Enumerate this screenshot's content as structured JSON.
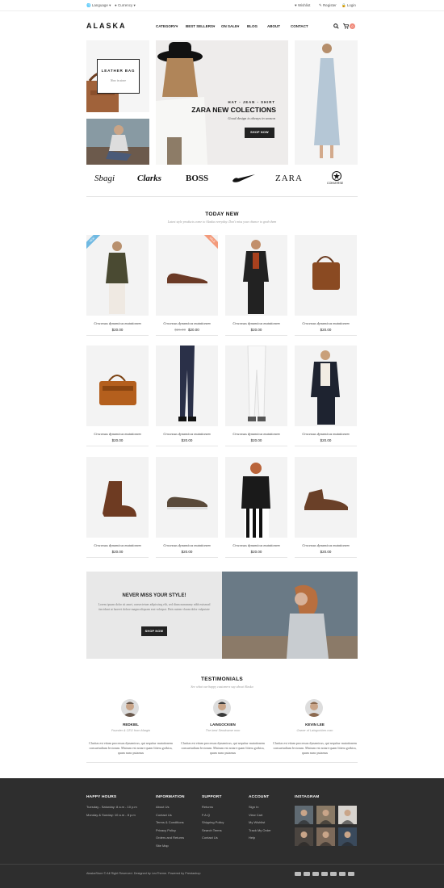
{
  "topbar": {
    "language": "Language",
    "currency": "Currency",
    "wishlist": "Wishlist",
    "register": "Register",
    "login": "Login"
  },
  "header": {
    "logo": "ALASKA",
    "nav": [
      "CATEGORY",
      "BEST SELLERS",
      "ON SALE",
      "BLOG",
      "ABOUT",
      "CONTACT"
    ],
    "cart_count": "0"
  },
  "hero": {
    "leather_title": "LEATHER BAG",
    "leather_sub": "Now in store",
    "tag": "HAT - JEAN - SHIRT",
    "title": "ZARA NEW COLECTIONS",
    "subtitle": "Good design is always in season",
    "button": "SHOP NOW"
  },
  "brands": [
    "Sbagi",
    "Clarks",
    "BOSS",
    "nike",
    "ZARA",
    "CONVERSE"
  ],
  "today": {
    "title": "TODAY NEW",
    "subtitle": "Latest style products come to Alaska everyday. Don't miss your chance to grab them"
  },
  "products": [
    {
      "name": "Crocessus dynamicus mutationem",
      "price": "$20.00",
      "old": "",
      "badge": "NEW"
    },
    {
      "name": "Crocessus dynamicus mutationem",
      "price": "$20.00",
      "old": "$26.00",
      "badge": "SALE"
    },
    {
      "name": "Crocessus dynamicus mutationem",
      "price": "$20.00",
      "old": "",
      "badge": ""
    },
    {
      "name": "Crocessus dynamicus mutationem",
      "price": "$20.00",
      "old": "",
      "badge": ""
    },
    {
      "name": "Crocessus dynamicus mutationem",
      "price": "$20.00",
      "old": "",
      "badge": ""
    },
    {
      "name": "Crocessus dynamicus mutationem",
      "price": "$20.00",
      "old": "",
      "badge": ""
    },
    {
      "name": "Crocessus dynamicus mutationem",
      "price": "$20.00",
      "old": "",
      "badge": ""
    },
    {
      "name": "Crocessus dynamicus mutationem",
      "price": "$20.00",
      "old": "",
      "badge": ""
    },
    {
      "name": "Crocessus dynamicus mutationem",
      "price": "$20.00",
      "old": "",
      "badge": ""
    },
    {
      "name": "Crocessus dynamicus mutationem",
      "price": "$20.00",
      "old": "",
      "badge": ""
    },
    {
      "name": "Crocessus dynamicus mutationem",
      "price": "$20.00",
      "old": "",
      "badge": ""
    },
    {
      "name": "Crocessus dynamicus mutationem",
      "price": "$20.00",
      "old": "",
      "badge": ""
    }
  ],
  "promo": {
    "title": "NEVER MISS YOUR STYLE!",
    "body": "Lorem ipsum dolor sit amet, consectetuer adipiscing elit, sed diam nonummy nibh euismod tincidunt ut laoreet dolore magna aliquam erat volutpat. Duis autem vlaum dolor vulputate",
    "button": "SHOP NOW"
  },
  "testimonials": {
    "title": "TESTIMONIALS",
    "subtitle": "See what our happy customers say about Alaska",
    "items": [
      {
        "name": "REDKIEL",
        "role": "Founder & CEO from Margin",
        "text": "Claritas est etiam processus dynamicus, qui sequitur mutationem consuetudium lectorum. Mairum est notare quam littera gothica, quam nunc putamus"
      },
      {
        "name": "LAINGOCKIEN",
        "role": "The best Sendname mon",
        "text": "Claritas est etiam processus dynamicus, qui sequitur mutationem consuetudium lectorum. Mairum est notare quam littera gothica, quam nunc putamus"
      },
      {
        "name": "KEVIN LEE",
        "role": "Owner of Laingockien.com",
        "text": "Claritas est etiam processus dynamicus, qui sequitur mutationem consuetudium lectorum. Mairum est notare quam littera gothica, quam nunc putamus"
      }
    ]
  },
  "footer": {
    "hours_title": "HAPPY HOURS",
    "hours": [
      "Tuesday - Saturday: 8 a.m - 10 p.m",
      "Monday & Sunday: 10 a.m - 8 p.m"
    ],
    "info_title": "INFORMATION",
    "info": [
      "About Us",
      "Contact Us",
      "Terms & Conditions",
      "Privacy Policy",
      "Orders and Returns",
      "Site Map"
    ],
    "support_title": "SUPPORT",
    "support": [
      "Returns",
      "F.A.Q",
      "Shipping Policy",
      "Search Terms",
      "Contact Us"
    ],
    "account_title": "ACCOUNT",
    "account": [
      "Sign In",
      "View Cart",
      "My Wishlist",
      "Track My Order",
      "Help"
    ],
    "instagram_title": "INSTAGRAM",
    "copyright": "AlaskaStore © All Right Reserved. Designed by LeoTheme. Powered by Prestashop"
  }
}
